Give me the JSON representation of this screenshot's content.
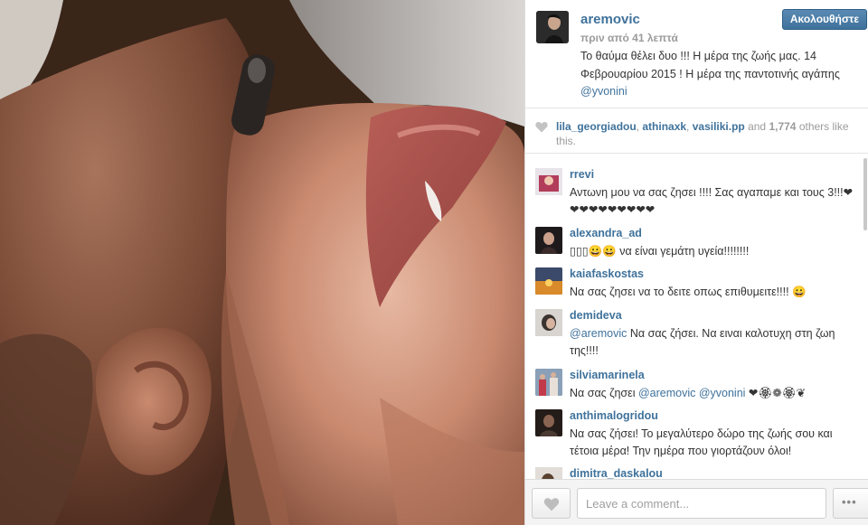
{
  "post": {
    "owner": "aremovic",
    "time": "πριν από 41 λεπτά",
    "follow_label": "Ακολουθήστε",
    "caption": "Το θαύμα θέλει δυο !!! Η μέρα της ζωής μας. 14 Φεβρουαρίου 2015 ! Η μέρα της παντοτινής αγάπης ",
    "caption_mention": "@yvonini"
  },
  "likes": {
    "users": [
      "lila_georgiadou",
      "athinaxk",
      "vasiliki.pp"
    ],
    "sep1": ", ",
    "sep2": ", ",
    "and_text": " and ",
    "count": "1,774",
    "suffix": " others like this."
  },
  "comments": [
    {
      "user": "rrevi",
      "text": "Αντωνη μου να σας ζησει !!!! Σας αγαπαμε και τους 3!!!❤❤❤❤❤❤❤❤❤❤"
    },
    {
      "user": "alexandra_ad",
      "text": "▯▯▯😀😀 να είναι γεμάτη υγεία!!!!!!!!"
    },
    {
      "user": "kaiafaskostas",
      "text": "Να σας ζησει να το δειτε οπως επιθυμειτε!!!! 😀"
    },
    {
      "user": "demideva",
      "mention": "@aremovic",
      "text": " Να σας ζήσει. Να ειναι καλοτυχη στη ζωη της!!!!"
    },
    {
      "user": "silviamarinela",
      "text_before": "Να σας ζησει ",
      "mention1": "@aremovic",
      "mention2": " @yvonini",
      "text_after": " ❤🏵❁🏵❦"
    },
    {
      "user": "anthimalogridou",
      "text": "Να σας ζήσει! Το μεγαλύτερο δώρο της ζωής σου και τέτοια μέρα! Την ημέρα που γιορτάζουν όλοι!"
    },
    {
      "user": "dimitra_daskalou",
      "text": ""
    }
  ],
  "composer": {
    "placeholder": "Leave a comment...",
    "more_label": "•••"
  },
  "colors": {
    "link": "#3f729b",
    "text": "#333333",
    "muted": "#9b9b9b"
  }
}
